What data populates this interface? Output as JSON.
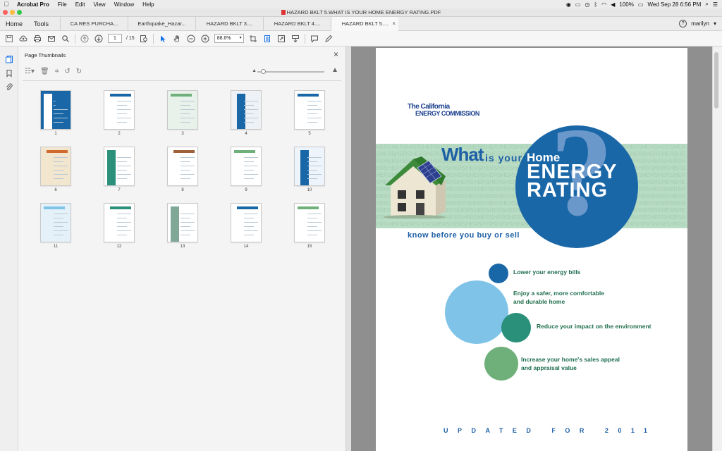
{
  "menubar": {
    "app_name": "Acrobat Pro",
    "items": [
      "File",
      "Edit",
      "View",
      "Window",
      "Help"
    ],
    "battery": "100%",
    "clock": "Wed Sep 28  6:56 PM"
  },
  "window": {
    "title": "HAZARD BKLT 5.WHAT IS YOUR HOME ENERGY RATING.PDF"
  },
  "tabs": {
    "home": "Home",
    "tools": "Tools",
    "documents": [
      {
        "label": "CA RES PURCHA..."
      },
      {
        "label": "Earthquake_Hazar..."
      },
      {
        "label": "HAZARD BKLT 3...."
      },
      {
        "label": "HAZARD BKLT 4...."
      },
      {
        "label": "HAZARD BKLT 5....",
        "close": "×"
      }
    ],
    "user": "marilyn",
    "help": "?"
  },
  "toolbar": {
    "current_page": "1",
    "page_count": "/ 15",
    "zoom": "88.6%"
  },
  "thumbnails_panel": {
    "title": "Page Thumbnails",
    "close": "×",
    "zoom_level": 0.05,
    "pages": [
      "1",
      "2",
      "3",
      "4",
      "5",
      "6",
      "7",
      "8",
      "9",
      "10",
      "11",
      "12",
      "13",
      "14",
      "15"
    ]
  },
  "document": {
    "cec_line1": "The California",
    "cec_line2": "ENERGY COMMISSION",
    "what": "What",
    "is_your": "is your",
    "home": "Home",
    "energy": "ENERGY",
    "rating": "RATING",
    "question_mark": "?",
    "band_text": "HERS",
    "tagline": "know before you buy or sell",
    "benefits": [
      {
        "line1": "Lower your energy bills",
        "line2": ""
      },
      {
        "line1": "Enjoy a safer, more comfortable",
        "line2": "and durable home"
      },
      {
        "line1": "Reduce your impact on the environment",
        "line2": ""
      },
      {
        "line1": "Increase your home's sales appeal",
        "line2": "and appraisal value"
      }
    ],
    "updated": "UPDATED FOR 2011"
  },
  "colors": {
    "brand_blue": "#1a67a8",
    "light_blue": "#7fc4e8",
    "teal": "#2a9079",
    "green": "#6fb07a",
    "band_green": "#b9dcc5"
  }
}
